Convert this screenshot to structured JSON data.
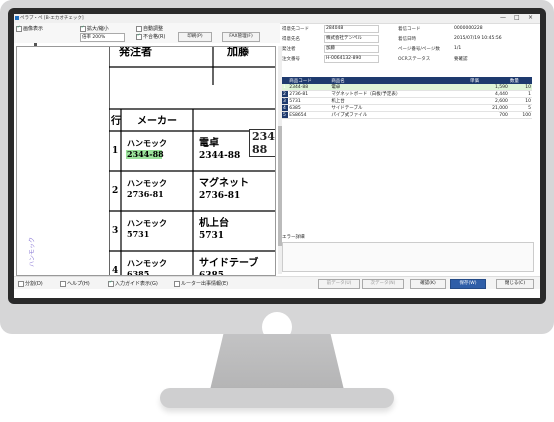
{
  "window": {
    "title": "ペラブ・ペ [B-エカオチェック]",
    "controls": [
      "—",
      "□",
      "×"
    ]
  },
  "toolbar": {
    "check_show_image": "画像表示",
    "check_zoom": "拡大/縮小",
    "check_auto_fit": "自動調整",
    "zoom_value": "倍率 200%",
    "check_pass": "不合格(R)",
    "print_button": "印刷(P)",
    "fax_button": "FAX管理(F)"
  },
  "document": {
    "header_left": "発注者",
    "header_right": "加藤",
    "zoom_callout": "2344-88",
    "col_row": "行",
    "col_maker": "メーカー",
    "rows": [
      {
        "no": "1",
        "maker": "ハンモック",
        "code": "2344-88",
        "item": "電卓",
        "item_code": "2344-88"
      },
      {
        "no": "2",
        "maker": "ハンモック",
        "code": "2736-81",
        "item": "マグネット",
        "item_code": "2736-81"
      },
      {
        "no": "3",
        "maker": "ハンモック",
        "code": "5731",
        "item": "机上台",
        "item_code": "5731"
      },
      {
        "no": "4",
        "maker": "ハンモック",
        "code": "6385",
        "item": "サイドテーブ",
        "item_code": "6385"
      }
    ],
    "side_stamp": "ハンモック"
  },
  "fields": {
    "customer_code_label": "得意先コード",
    "customer_code": "284048",
    "recv_code_label": "着信コード",
    "recv_code": "0000000228",
    "customer_name_label": "得意先名",
    "customer_name": "株式会社テンペル",
    "recv_datetime_label": "着信日時",
    "recv_datetime": "2015/07/19 10:45:56",
    "orderer_label": "発注者",
    "orderer": "加藤",
    "page_label": "ページ番号/ページ数",
    "page": "1/1",
    "order_no_label": "注文番号",
    "order_no": "H-0064132-890",
    "ocr_status_label": "OCRステータス",
    "ocr_status": "要確認"
  },
  "grid": {
    "headers": [
      "商品コード",
      "商品名",
      "単価",
      "数量"
    ],
    "rows": [
      {
        "idx": "1",
        "code": "2344-88",
        "name": "電卓",
        "price": "1,590",
        "qty": "10"
      },
      {
        "idx": "2",
        "code": "2736-81",
        "name": "マグネットボード（白板/予定表）",
        "price": "4,440",
        "qty": "1"
      },
      {
        "idx": "3",
        "code": "5731",
        "name": "机上台",
        "price": "2,600",
        "qty": "10"
      },
      {
        "idx": "4",
        "code": "6385",
        "name": "サイドテーブル",
        "price": "21,000",
        "qty": "5"
      },
      {
        "idx": "5",
        "code": "ES8654",
        "name": "パイプ式ファイル",
        "price": "700",
        "qty": "100"
      }
    ]
  },
  "error_label": "エラー詳細",
  "bottom": {
    "chk_split": "分割(D)",
    "chk_help": "ヘルプ(H)",
    "chk_input": "入力ガイド表示(G)",
    "chk_route": "ルーター出事情報(E)",
    "prev": "前データ(U)",
    "next": "次データ(N)",
    "confirm": "確認(K)",
    "save": "保存(W)",
    "close": "閉じる(C)"
  },
  "colors": {
    "grid_header": "#1e3a6e",
    "selected_row": "#dff5d8",
    "save_button": "#2f5ea8"
  }
}
